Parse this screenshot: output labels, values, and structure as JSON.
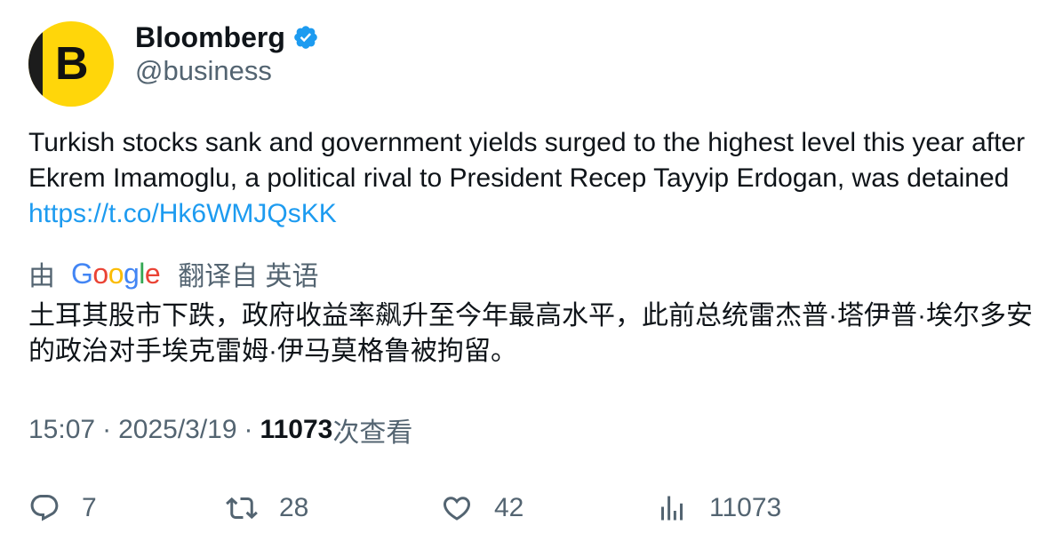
{
  "author": {
    "avatar_letter": "B",
    "name": "Bloomberg",
    "handle": "@business",
    "verified_icon": "verified-badge-icon"
  },
  "tweet": {
    "text": "Turkish stocks sank and government yields surged to the highest level this year after Ekrem Imamoglu, a political rival to President Recep Tayyip Erdogan, was detained",
    "link": "https://t.co/Hk6WMJQsKK"
  },
  "translation": {
    "prefix": "由",
    "provider": "Google",
    "suffix": "翻译自 英语",
    "text": "土耳其股市下跌，政府收益率飙升至今年最高水平，此前总统雷杰普·塔伊普·埃尔多安的政治对手埃克雷姆·伊马莫格鲁被拘留。"
  },
  "meta": {
    "time": "15:07",
    "sep1": "·",
    "date": "2025/3/19",
    "sep2": "·",
    "views": "11073",
    "views_label": "次查看"
  },
  "actions": {
    "reply_count": "7",
    "retweet_count": "28",
    "like_count": "42",
    "views_count": "11073"
  },
  "colors": {
    "accent": "#1d9bf0",
    "muted": "#536471",
    "text": "#0f1419",
    "brand_yellow": "#ffd60a"
  }
}
